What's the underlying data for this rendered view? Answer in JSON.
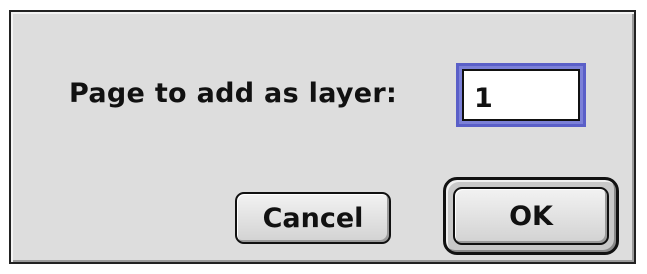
{
  "dialog": {
    "prompt_label": "Page to add as layer:",
    "page_input": {
      "value": "1"
    },
    "buttons": {
      "cancel_label": "Cancel",
      "ok_label": "OK"
    }
  }
}
